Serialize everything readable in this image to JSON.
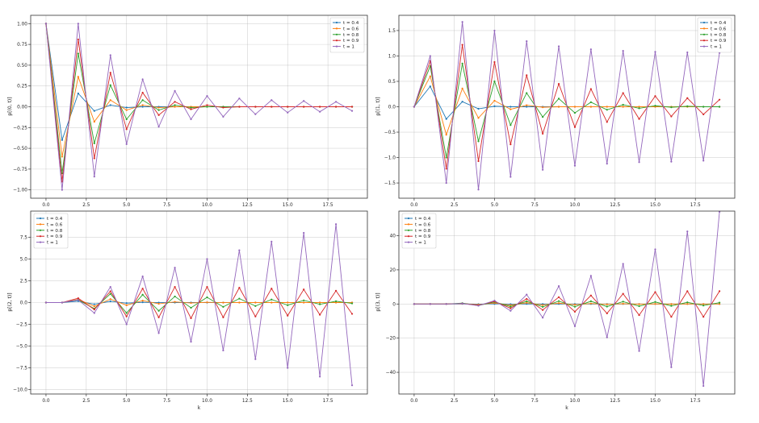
{
  "figure": {
    "colors": [
      "#1f77b4",
      "#ff7f0e",
      "#2ca02c",
      "#d62728",
      "#9467bd"
    ],
    "legend_position": "top-right for upper panels, top-left for lower panels"
  },
  "chart_data": [
    {
      "type": "line",
      "title": "",
      "xlabel": "",
      "ylabel": "p[(0, t)]",
      "xlim": [
        -0.95,
        19.95
      ],
      "ylim": [
        -1.1,
        1.1
      ],
      "xticks": [
        "0.0",
        "2.5",
        "5.0",
        "7.5",
        "10.0",
        "12.5",
        "15.0",
        "17.5"
      ],
      "xtick_values": [
        0,
        2.5,
        5,
        7.5,
        10,
        12.5,
        15,
        17.5
      ],
      "yticks": [
        "−1.00",
        "−0.75",
        "−0.50",
        "−0.25",
        "0.00",
        "0.25",
        "0.50",
        "0.75",
        "1.00"
      ],
      "ytick_values": [
        -1,
        -0.75,
        -0.5,
        -0.25,
        0,
        0.25,
        0.5,
        0.75,
        1
      ],
      "grid": true,
      "legend_position": "top-right",
      "x": [
        0,
        1,
        2,
        3,
        4,
        5,
        6,
        7,
        8,
        9,
        10,
        11,
        12,
        13,
        14,
        15,
        16,
        17,
        18,
        19
      ],
      "series": [
        {
          "name": "t = 0.4",
          "values": [
            1.0,
            -0.4,
            0.16,
            -0.05,
            0.02,
            -0.01,
            0.0,
            0.0,
            0.0,
            0.0,
            0.0,
            0.0,
            0.0,
            0.0,
            0.0,
            0.0,
            0.0,
            0.0,
            0.0,
            0.0
          ]
        },
        {
          "name": "t = 0.6",
          "values": [
            1.0,
            -0.6,
            0.36,
            -0.18,
            0.08,
            -0.04,
            0.02,
            -0.01,
            0.0,
            0.0,
            0.0,
            0.0,
            0.0,
            0.0,
            0.0,
            0.0,
            0.0,
            0.0,
            0.0,
            0.0
          ]
        },
        {
          "name": "t = 0.8",
          "values": [
            1.0,
            -0.8,
            0.64,
            -0.44,
            0.26,
            -0.15,
            0.08,
            -0.04,
            0.02,
            -0.01,
            0.0,
            0.0,
            0.0,
            0.0,
            0.0,
            0.0,
            0.0,
            0.0,
            0.0,
            0.0
          ]
        },
        {
          "name": "t = 0.9",
          "values": [
            1.0,
            -0.9,
            0.81,
            -0.62,
            0.41,
            -0.27,
            0.17,
            -0.1,
            0.06,
            -0.03,
            0.02,
            -0.01,
            0.0,
            0.0,
            0.0,
            0.0,
            0.0,
            0.0,
            0.0,
            0.0
          ]
        },
        {
          "name": "t = 1",
          "values": [
            1.0,
            -1.0,
            1.0,
            -0.84,
            0.62,
            -0.45,
            0.33,
            -0.24,
            0.19,
            -0.15,
            0.13,
            -0.12,
            0.1,
            -0.09,
            0.08,
            -0.07,
            0.07,
            -0.06,
            0.06,
            -0.05
          ]
        }
      ]
    },
    {
      "type": "line",
      "title": "",
      "xlabel": "",
      "ylabel": "p[(1, t)]",
      "xlim": [
        -0.95,
        19.95
      ],
      "ylim": [
        -1.8,
        1.8
      ],
      "xticks": [
        "0.0",
        "2.5",
        "5.0",
        "7.5",
        "10.0",
        "12.5",
        "15.0",
        "17.5"
      ],
      "xtick_values": [
        0,
        2.5,
        5,
        7.5,
        10,
        12.5,
        15,
        17.5
      ],
      "yticks": [
        "−1.5",
        "−1.0",
        "−0.5",
        "0.0",
        "0.5",
        "1.0",
        "1.5"
      ],
      "ytick_values": [
        -1.5,
        -1,
        -0.5,
        0,
        0.5,
        1,
        1.5
      ],
      "grid": true,
      "legend_position": "top-right",
      "x": [
        0,
        1,
        2,
        3,
        4,
        5,
        6,
        7,
        8,
        9,
        10,
        11,
        12,
        13,
        14,
        15,
        16,
        17,
        18,
        19
      ],
      "series": [
        {
          "name": "t = 0.4",
          "values": [
            0.0,
            0.4,
            -0.24,
            0.1,
            -0.04,
            0.01,
            0.0,
            0.0,
            0.0,
            0.0,
            0.0,
            0.0,
            0.0,
            0.0,
            0.0,
            0.0,
            0.0,
            0.0,
            0.0,
            0.0
          ]
        },
        {
          "name": "t = 0.6",
          "values": [
            0.0,
            0.6,
            -0.55,
            0.36,
            -0.22,
            0.12,
            -0.05,
            0.03,
            -0.01,
            0.0,
            0.0,
            0.0,
            0.0,
            0.0,
            0.0,
            0.0,
            0.0,
            0.0,
            0.0,
            0.0
          ]
        },
        {
          "name": "t = 0.8",
          "values": [
            0.0,
            0.8,
            -1.0,
            0.85,
            -0.68,
            0.5,
            -0.36,
            0.27,
            -0.2,
            0.16,
            -0.12,
            0.09,
            -0.06,
            0.04,
            -0.03,
            0.02,
            -0.01,
            0.01,
            0.0,
            0.0
          ]
        },
        {
          "name": "t = 0.9",
          "values": [
            0.0,
            0.9,
            -1.22,
            1.22,
            -1.07,
            0.88,
            -0.74,
            0.62,
            -0.53,
            0.45,
            -0.4,
            0.35,
            -0.3,
            0.27,
            -0.24,
            0.21,
            -0.19,
            0.17,
            -0.15,
            0.14
          ]
        },
        {
          "name": "t = 1",
          "values": [
            0.0,
            1.0,
            -1.5,
            1.67,
            -1.63,
            1.5,
            -1.38,
            1.29,
            -1.24,
            1.19,
            -1.16,
            1.13,
            -1.12,
            1.1,
            -1.09,
            1.08,
            -1.08,
            1.07,
            -1.06,
            1.06
          ]
        }
      ]
    },
    {
      "type": "line",
      "title": "",
      "xlabel": "k",
      "ylabel": "p[(2, t)]",
      "xlim": [
        -0.95,
        19.95
      ],
      "ylim": [
        -10.5,
        10.5
      ],
      "xticks": [
        "0.0",
        "2.5",
        "5.0",
        "7.5",
        "10.0",
        "12.5",
        "15.0",
        "17.5"
      ],
      "xtick_values": [
        0,
        2.5,
        5,
        7.5,
        10,
        12.5,
        15,
        17.5
      ],
      "yticks": [
        "−10.0",
        "−7.5",
        "−5.0",
        "−2.5",
        "0.0",
        "2.5",
        "5.0",
        "7.5"
      ],
      "ytick_values": [
        -10,
        -7.5,
        -5,
        -2.5,
        0,
        2.5,
        5,
        7.5
      ],
      "grid": true,
      "legend_position": "top-left",
      "x": [
        0,
        1,
        2,
        3,
        4,
        5,
        6,
        7,
        8,
        9,
        10,
        11,
        12,
        13,
        14,
        15,
        16,
        17,
        18,
        19
      ],
      "series": [
        {
          "name": "t = 0.4",
          "values": [
            0.0,
            0.0,
            0.16,
            -0.19,
            0.14,
            -0.07,
            0.03,
            -0.01,
            0.0,
            0.0,
            0.0,
            0.0,
            0.0,
            0.0,
            0.0,
            0.0,
            0.0,
            0.0,
            0.0,
            0.0
          ]
        },
        {
          "name": "t = 0.6",
          "values": [
            0.0,
            0.0,
            0.36,
            -0.43,
            0.4,
            -0.31,
            0.22,
            -0.14,
            0.08,
            -0.05,
            0.03,
            -0.01,
            0.0,
            0.0,
            0.0,
            0.0,
            0.0,
            0.0,
            0.0,
            0.0
          ]
        },
        {
          "name": "t = 0.8",
          "values": [
            0.0,
            0.0,
            0.3,
            -0.7,
            1.0,
            -1.2,
            0.9,
            -0.95,
            0.7,
            -0.6,
            0.6,
            -0.5,
            0.45,
            -0.4,
            0.35,
            -0.3,
            0.25,
            -0.2,
            0.15,
            -0.1
          ]
        },
        {
          "name": "t = 0.9",
          "values": [
            0.0,
            0.0,
            0.5,
            -0.8,
            1.3,
            -1.6,
            1.6,
            -1.7,
            1.8,
            -1.8,
            1.8,
            -1.7,
            1.7,
            -1.6,
            1.6,
            -1.5,
            1.5,
            -1.4,
            1.35,
            -1.3
          ]
        },
        {
          "name": "t = 1",
          "values": [
            0.0,
            0.0,
            0.3,
            -1.2,
            1.8,
            -2.5,
            3.0,
            -3.5,
            4.0,
            -4.5,
            5.0,
            -5.5,
            6.0,
            -6.5,
            7.0,
            -7.5,
            8.0,
            -8.5,
            9.0,
            -9.5
          ]
        }
      ]
    },
    {
      "type": "line",
      "title": "",
      "xlabel": "k",
      "ylabel": "p[(3, t)]",
      "xlim": [
        -0.95,
        19.95
      ],
      "ylim": [
        -52.7,
        54.4
      ],
      "xticks": [
        "0.0",
        "2.5",
        "5.0",
        "7.5",
        "10.0",
        "12.5",
        "15.0",
        "17.5"
      ],
      "xtick_values": [
        0,
        2.5,
        5,
        7.5,
        10,
        12.5,
        15,
        17.5
      ],
      "yticks": [
        "−40",
        "−20",
        "0",
        "20",
        "40"
      ],
      "ytick_values": [
        -40,
        -20,
        0,
        20,
        40
      ],
      "grid": true,
      "legend_position": "top-left",
      "x": [
        0,
        1,
        2,
        3,
        4,
        5,
        6,
        7,
        8,
        9,
        10,
        11,
        12,
        13,
        14,
        15,
        16,
        17,
        18,
        19
      ],
      "series": [
        {
          "name": "t = 0.4",
          "values": [
            0.0,
            0.0,
            0.0,
            0.06,
            -0.1,
            0.1,
            -0.08,
            0.05,
            -0.03,
            0.01,
            0.0,
            0.0,
            0.0,
            0.0,
            0.0,
            0.0,
            0.0,
            0.0,
            0.0,
            0.0
          ]
        },
        {
          "name": "t = 0.6",
          "values": [
            0.0,
            0.0,
            0.0,
            0.2,
            -0.4,
            0.6,
            -0.7,
            0.7,
            -0.6,
            0.5,
            -0.4,
            0.3,
            -0.2,
            0.15,
            -0.1,
            0.05,
            -0.03,
            0.02,
            -0.01,
            0.0
          ]
        },
        {
          "name": "t = 0.8",
          "values": [
            0.0,
            0.0,
            0.0,
            0.5,
            -0.9,
            1.2,
            -1.5,
            1.6,
            -1.7,
            1.7,
            -1.6,
            1.6,
            -1.5,
            1.4,
            -1.3,
            1.2,
            -1.1,
            1.0,
            -0.9,
            0.8
          ]
        },
        {
          "name": "t = 0.9",
          "values": [
            0.0,
            0.0,
            0.0,
            0.3,
            -0.8,
            1.5,
            -2.5,
            3.0,
            -3.5,
            4.0,
            -4.5,
            5.0,
            -5.5,
            6.0,
            -6.5,
            7.0,
            -7.5,
            7.5,
            -7.5,
            7.5
          ]
        },
        {
          "name": "t = 1",
          "values": [
            0.0,
            0.0,
            0.0,
            0.3,
            -1.0,
            2.0,
            -4.0,
            5.5,
            -8.0,
            10.5,
            -13.0,
            16.5,
            -19.5,
            23.5,
            -27.5,
            32.0,
            -37.0,
            42.5,
            -48.0,
            54.0
          ]
        }
      ]
    }
  ]
}
